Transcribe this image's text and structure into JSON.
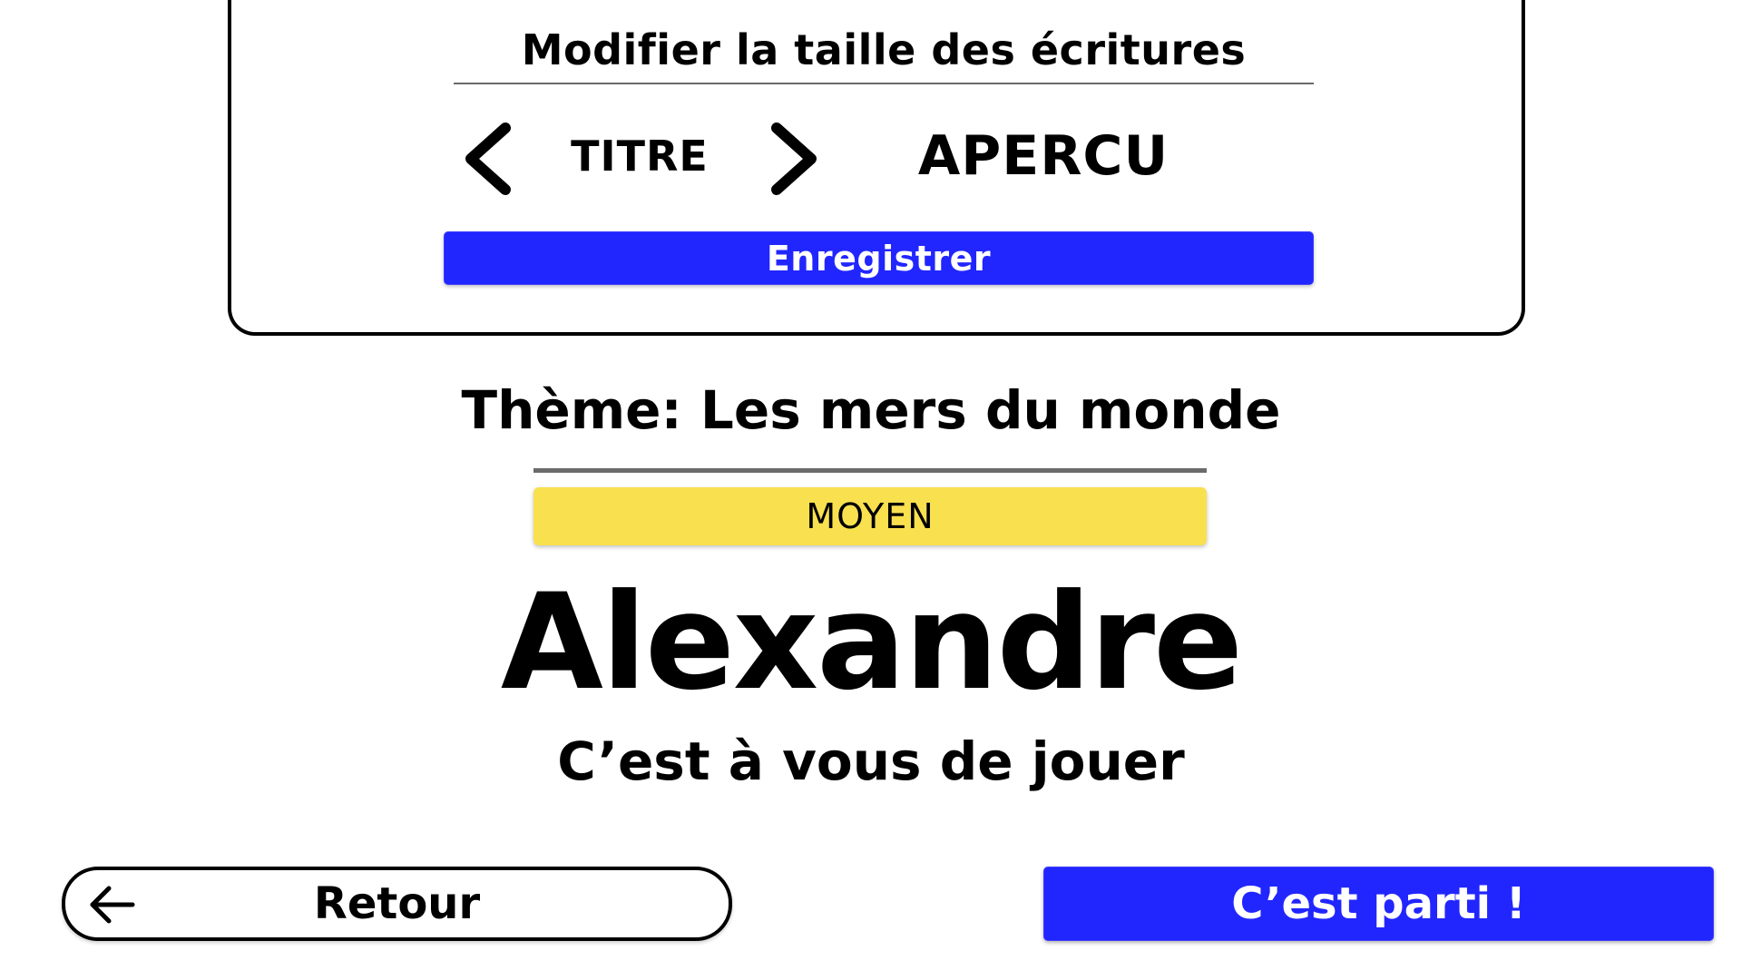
{
  "colors": {
    "primary_blue": "#2126ff",
    "level_yellow": "#f9e04f",
    "divider_gray": "#6b6b6b",
    "text": "#000000",
    "background": "#ffffff"
  },
  "settings": {
    "title": "Modifier la taille des écritures",
    "prev_icon": "chevron-left-icon",
    "next_icon": "chevron-right-icon",
    "target_label": "TITRE",
    "preview_label": "APERCU",
    "save_label": "Enregistrer"
  },
  "game": {
    "theme": "Thème: Les mers du monde",
    "level": "MOYEN",
    "player_name": "Alexandre",
    "turn_message": "C’est à vous de jouer"
  },
  "actions": {
    "back_icon": "arrow-left-icon",
    "back_label": "Retour",
    "start_label": "C’est parti !"
  }
}
